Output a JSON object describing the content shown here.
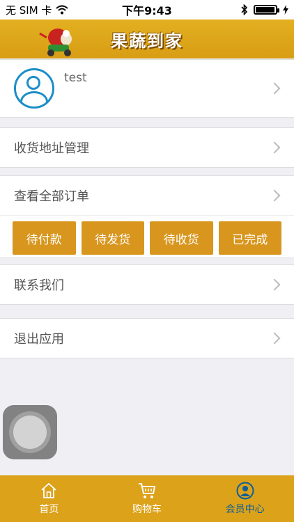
{
  "status_bar": {
    "carrier": "无 SIM 卡",
    "time": "下午9:43"
  },
  "header": {
    "title": "果蔬到家"
  },
  "profile": {
    "username": "test"
  },
  "menu": {
    "address": "收货地址管理",
    "orders": "查看全部订单",
    "contact": "联系我们",
    "logout": "退出应用"
  },
  "order_buttons": [
    "待付款",
    "待发货",
    "待收货",
    "已完成"
  ],
  "tabbar": {
    "tabs": [
      {
        "label": "首页",
        "icon": "home-icon"
      },
      {
        "label": "购物车",
        "icon": "cart-icon"
      },
      {
        "label": "会员中心",
        "icon": "member-icon"
      }
    ],
    "active": "会员中心"
  },
  "colors": {
    "accent": "#dca21a",
    "button": "#d8961e",
    "active_tab": "#0f5f98",
    "avatar": "#1c8ec7"
  }
}
